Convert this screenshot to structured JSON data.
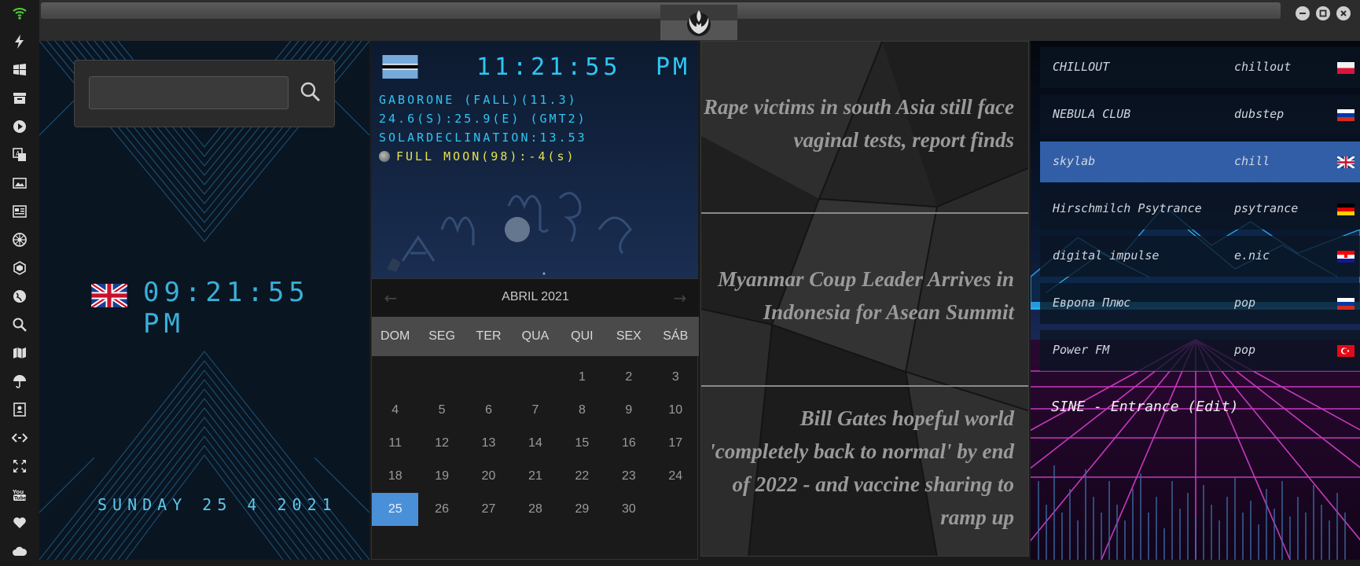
{
  "sidebar": {
    "icons": [
      "wifi-icon",
      "lightning-icon",
      "windows-icon",
      "archive-icon",
      "play-icon",
      "translate-icon",
      "image-icon",
      "news-icon",
      "wheel-icon",
      "hexagon-icon",
      "globe-icon",
      "search-icon",
      "map-icon",
      "umbrella-icon",
      "contacts-icon",
      "code-icon",
      "expand-icon",
      "youtube-icon",
      "heart-icon",
      "cloud-icon"
    ],
    "accent": "#4fd13a"
  },
  "window": {
    "controls": [
      "minimize",
      "maximize",
      "close"
    ]
  },
  "uk_clock": {
    "search_value": "",
    "time": "09:21:55 PM",
    "date": "SUNDAY 25 4 2021"
  },
  "world_clock": {
    "time": "11:21:55",
    "ampm": "PM",
    "line1": "GABORONE (FALL)(11.3)",
    "line2": "24.6(S):25.9(E) (GMT2)",
    "line3": "SOLARDECLINATION:13.53",
    "moon": "FULL MOON(98):-4",
    "moon_suffix": "(s)"
  },
  "calendar": {
    "title": "ABRIL 2021",
    "prev": "←",
    "next": "→",
    "weekdays": [
      "DOM",
      "SEG",
      "TER",
      "QUA",
      "QUI",
      "SEX",
      "SÁB"
    ],
    "leading_blanks": 4,
    "days": [
      "1",
      "2",
      "3",
      "4",
      "5",
      "6",
      "7",
      "8",
      "9",
      "10",
      "11",
      "12",
      "13",
      "14",
      "15",
      "16",
      "17",
      "18",
      "19",
      "20",
      "21",
      "22",
      "23",
      "24",
      "25",
      "26",
      "27",
      "28",
      "29",
      "30"
    ],
    "selected": "25"
  },
  "news": {
    "items": [
      "Rape victims in south Asia still face vaginal tests, report finds",
      "Myanmar Coup Leader Arrives in Indonesia for Asean Summit",
      "Bill Gates hopeful world 'completely back to normal' by end of 2022 - and vaccine sharing to ramp up"
    ]
  },
  "radio": {
    "stations": [
      {
        "name": "CHILLOUT",
        "genre": "chillout",
        "flag": "pl"
      },
      {
        "name": "NEBULA CLUB",
        "genre": "dubstep",
        "flag": "ru"
      },
      {
        "name": "skylab",
        "genre": "chill",
        "flag": "gb"
      },
      {
        "name": "Hirschmilch Psytrance",
        "genre": "psytrance",
        "flag": "de"
      },
      {
        "name": "digital impulse",
        "genre": "e.nic",
        "flag": "hr"
      },
      {
        "name": "Европа Плюс",
        "genre": "pop",
        "flag": "ru"
      },
      {
        "name": "Power FM",
        "genre": "pop",
        "flag": "tr"
      }
    ],
    "active_index": 2,
    "now_playing": "SINE - Entrance (Edit)"
  }
}
